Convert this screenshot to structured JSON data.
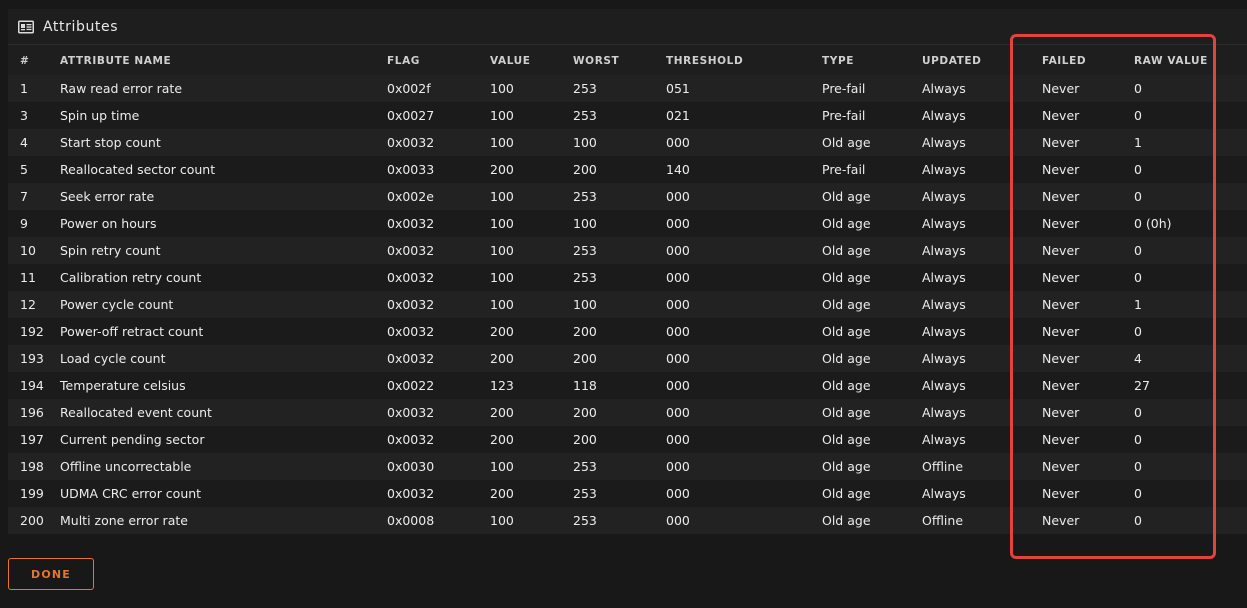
{
  "panel": {
    "title": "Attributes",
    "icon": "id-card-icon"
  },
  "table": {
    "headers": [
      "#",
      "ATTRIBUTE NAME",
      "FLAG",
      "VALUE",
      "WORST",
      "THRESHOLD",
      "TYPE",
      "UPDATED",
      "FAILED",
      "RAW VALUE"
    ],
    "rows": [
      [
        "1",
        "Raw read error rate",
        "0x002f",
        "100",
        "253",
        "051",
        "Pre-fail",
        "Always",
        "Never",
        "0"
      ],
      [
        "3",
        "Spin up time",
        "0x0027",
        "100",
        "253",
        "021",
        "Pre-fail",
        "Always",
        "Never",
        "0"
      ],
      [
        "4",
        "Start stop count",
        "0x0032",
        "100",
        "100",
        "000",
        "Old age",
        "Always",
        "Never",
        "1"
      ],
      [
        "5",
        "Reallocated sector count",
        "0x0033",
        "200",
        "200",
        "140",
        "Pre-fail",
        "Always",
        "Never",
        "0"
      ],
      [
        "7",
        "Seek error rate",
        "0x002e",
        "100",
        "253",
        "000",
        "Old age",
        "Always",
        "Never",
        "0"
      ],
      [
        "9",
        "Power on hours",
        "0x0032",
        "100",
        "100",
        "000",
        "Old age",
        "Always",
        "Never",
        "0 (0h)"
      ],
      [
        "10",
        "Spin retry count",
        "0x0032",
        "100",
        "253",
        "000",
        "Old age",
        "Always",
        "Never",
        "0"
      ],
      [
        "11",
        "Calibration retry count",
        "0x0032",
        "100",
        "253",
        "000",
        "Old age",
        "Always",
        "Never",
        "0"
      ],
      [
        "12",
        "Power cycle count",
        "0x0032",
        "100",
        "100",
        "000",
        "Old age",
        "Always",
        "Never",
        "1"
      ],
      [
        "192",
        "Power-off retract count",
        "0x0032",
        "200",
        "200",
        "000",
        "Old age",
        "Always",
        "Never",
        "0"
      ],
      [
        "193",
        "Load cycle count",
        "0x0032",
        "200",
        "200",
        "000",
        "Old age",
        "Always",
        "Never",
        "4"
      ],
      [
        "194",
        "Temperature celsius",
        "0x0022",
        "123",
        "118",
        "000",
        "Old age",
        "Always",
        "Never",
        "27"
      ],
      [
        "196",
        "Reallocated event count",
        "0x0032",
        "200",
        "200",
        "000",
        "Old age",
        "Always",
        "Never",
        "0"
      ],
      [
        "197",
        "Current pending sector",
        "0x0032",
        "200",
        "200",
        "000",
        "Old age",
        "Always",
        "Never",
        "0"
      ],
      [
        "198",
        "Offline uncorrectable",
        "0x0030",
        "100",
        "253",
        "000",
        "Old age",
        "Offline",
        "Never",
        "0"
      ],
      [
        "199",
        "UDMA CRC error count",
        "0x0032",
        "200",
        "253",
        "000",
        "Old age",
        "Always",
        "Never",
        "0"
      ],
      [
        "200",
        "Multi zone error rate",
        "0x0008",
        "100",
        "253",
        "000",
        "Old age",
        "Offline",
        "Never",
        "0"
      ]
    ]
  },
  "footer": {
    "done_label": "DONE"
  },
  "colors": {
    "accent": "#e8742f",
    "highlight": "#e0443a",
    "background": "#181818",
    "panel": "#1e1e1e"
  }
}
